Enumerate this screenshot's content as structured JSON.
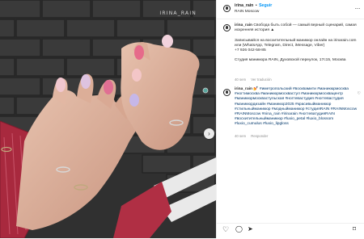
{
  "photo": {
    "watermark": "IRINA_RAIN",
    "next_icon": "chevron-right-icon"
  },
  "header": {
    "username": "irina_rain",
    "dot": "•",
    "follow": "Seguir",
    "location": "RAIN Moscow",
    "more_icon": "more-icon",
    "more_glyph": "···"
  },
  "caption": {
    "username": "irina_rain",
    "lines": "Свобода быть собой — самый верный сценарий, самая искренняя история ▲\n\nЗаписывайся на восхитительный маникюр онлайн на irinarain.com\nили (WhatsApp, Telegram, Direct, iMessage, Viber)\n+7 926 042-58-85\n\nСтудия маникюра RAIN, Духовской переулок, 17с15, Москва",
    "time": "40 sem",
    "translate": "Ver tradución"
  },
  "comment": {
    "username": "irina_rain",
    "emoji": "💅",
    "tags": "#иметропольский #восквамити #маникюрмосква #ногтимосква #маникюрмосквастул #маникюрмосквацентр #маникюрмосквастульская #ногтевастудия #ногтевастудия #маникюрдизайн #маникюр2025 #красивыйманикюр #стильныйманикюр #модныйманикюр #студияRAIN #RAINMoscow #RAINMoscow #nina_rain #irinarain #ногтеватудияRAIN #восхитительныйманикюр #luxio_petal #luxio_blossom #luxio_cumulus #luxio_lipgloss",
    "time": "40 sem",
    "reply": "Responder",
    "like_icon": "heart-outline-icon"
  },
  "actions": {
    "like_icon": "heart-icon",
    "comment_icon": "comment-icon",
    "share_icon": "share-icon",
    "save_icon": "bookmark-icon"
  },
  "colors": {
    "link": "#00376b",
    "follow": "#0095f6",
    "meta": "#8e8e8e"
  }
}
